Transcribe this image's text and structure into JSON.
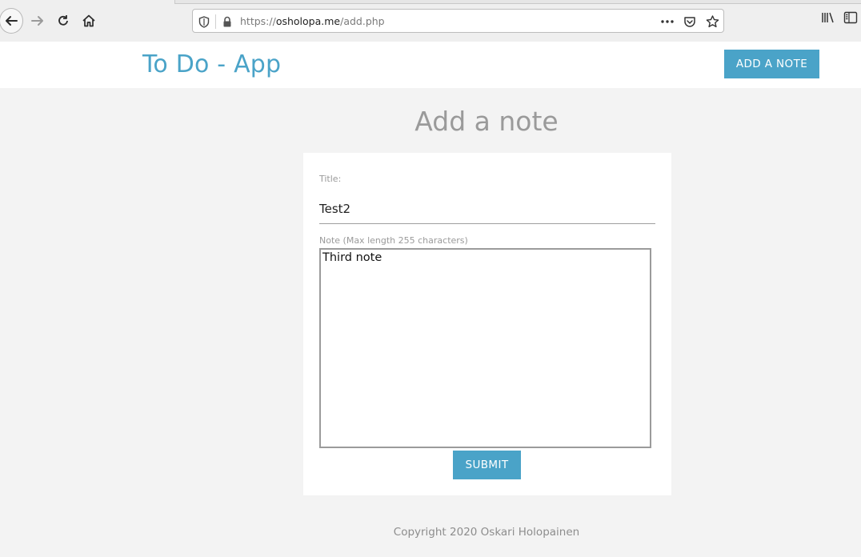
{
  "browser": {
    "url_scheme": "https://",
    "url_host": "osholopa.me",
    "url_path": "/add.php",
    "icons": {
      "back": "back-arrow-icon",
      "forward": "forward-arrow-icon",
      "reload": "reload-icon",
      "home": "home-icon",
      "tracking": "shield-icon",
      "lock": "lock-icon",
      "page_actions": "more-dots-icon",
      "pocket": "pocket-icon",
      "bookmark": "star-icon",
      "library": "library-icon",
      "sidebar": "sidebar-icon"
    }
  },
  "header": {
    "app_title": "To Do - App",
    "add_note_label": "ADD A NOTE"
  },
  "main": {
    "heading": "Add a note",
    "form": {
      "title_label": "Title:",
      "title_value": "Test2",
      "note_label": "Note (Max length 255 characters)",
      "note_value": "Third note",
      "submit_label": "SUBMIT"
    }
  },
  "footer": {
    "copyright": "Copyright 2020 Oskari Holopainen"
  },
  "colors": {
    "accent": "#4aa3c8",
    "page_bg": "#f3f3f3",
    "card_bg": "#ffffff",
    "muted_text": "#9a9a9a"
  }
}
